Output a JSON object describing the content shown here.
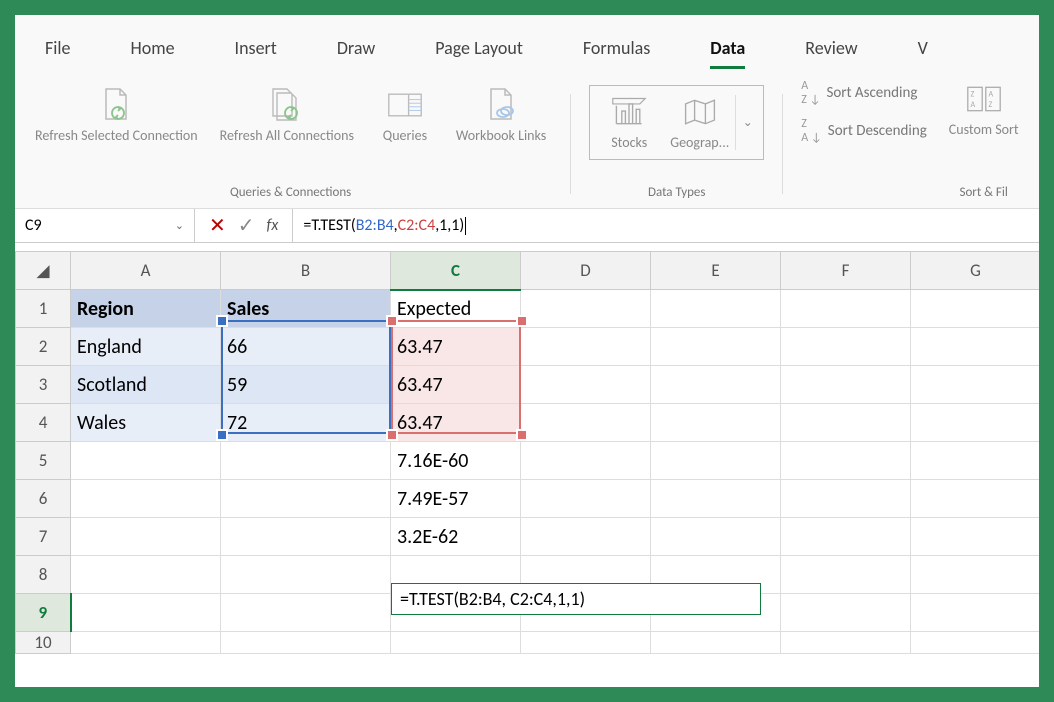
{
  "tabs": {
    "file": "File",
    "home": "Home",
    "insert": "Insert",
    "draw": "Draw",
    "page_layout": "Page Layout",
    "formulas": "Formulas",
    "data": "Data",
    "review": "Review",
    "view": "V"
  },
  "ribbon": {
    "refresh_selected": "Refresh Selected Connection",
    "refresh_all": "Refresh All Connections",
    "queries": "Queries",
    "workbook_links": "Workbook Links",
    "group_queries": "Queries & Connections",
    "stocks": "Stocks",
    "geograp": "Geograp...",
    "group_datatypes": "Data Types",
    "sort_asc": "Sort Ascending",
    "sort_desc": "Sort Descending",
    "custom_sort": "Custom Sort",
    "group_sort": "Sort & Fil"
  },
  "name_box": "C9",
  "formula": {
    "prefix": "=T.TEST(",
    "ref1": "B2:B4",
    "sep1": ", ",
    "ref2": "C2:C4",
    "suffix": ",1,1)"
  },
  "columns": [
    "A",
    "B",
    "C",
    "D",
    "E",
    "F",
    "G"
  ],
  "rows": [
    "1",
    "2",
    "3",
    "4",
    "5",
    "6",
    "7",
    "8",
    "9",
    "10"
  ],
  "cells": {
    "A1": "Region",
    "B1": "Sales",
    "C1": "Expected",
    "A2": "England",
    "B2": "66",
    "C2": "63.47",
    "A3": "Scotland",
    "B3": "59",
    "C3": "63.47",
    "A4": "Wales",
    "B4": "72",
    "C4": "63.47",
    "C5": "7.16E-60",
    "C6": "7.49E-57",
    "C7": "3.2E-62",
    "C9_overlay": "=T.TEST(B2:B4, C2:C4,1,1)"
  }
}
